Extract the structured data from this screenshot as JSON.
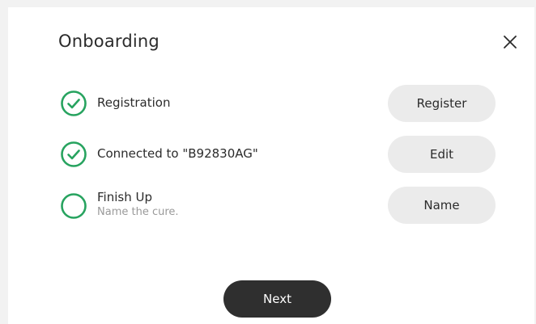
{
  "dialog": {
    "title": "Onboarding",
    "close_icon": "close-icon"
  },
  "steps": [
    {
      "label": "Registration",
      "sublabel": "",
      "status": "complete",
      "icon": "check-circle-icon",
      "button_label": "Register"
    },
    {
      "label": "Connected to \"B92830AG\"",
      "sublabel": "",
      "status": "complete",
      "icon": "check-circle-icon",
      "button_label": "Edit"
    },
    {
      "label": "Finish Up",
      "sublabel": "Name the cure.",
      "status": "pending",
      "icon": "empty-circle-icon",
      "button_label": "Name"
    }
  ],
  "footer": {
    "next_label": "Next"
  },
  "colors": {
    "accent_green": "#27a35f",
    "button_bg": "#ebebeb",
    "primary_button_bg": "#2f2f2f",
    "muted_text": "#9a9a9a"
  }
}
